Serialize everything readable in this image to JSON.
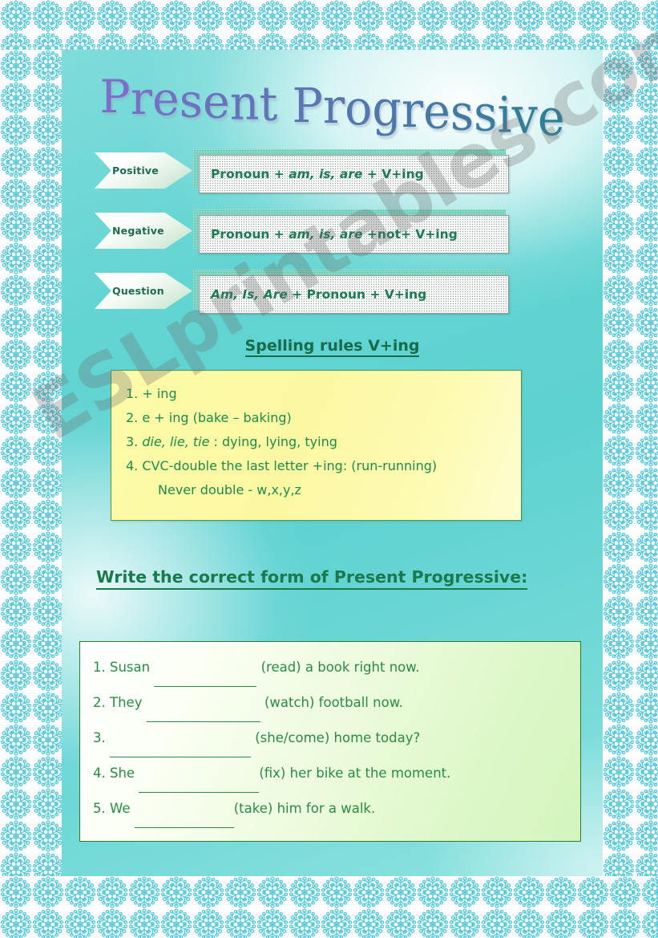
{
  "worksheet": {
    "title": "Present Progressive",
    "watermark": "ESLprintables.com",
    "colors": {
      "panel_teal": "#62d4d2",
      "heading_green": "#176b4a",
      "formula_green": "#1c7a57",
      "rules_yellow": "#fdfba9",
      "exercise_green": "#ddf7c8",
      "snowflake_cyan": "#4fc6d8",
      "title_start": "#7b6fc9",
      "title_end": "#2f7f96"
    }
  },
  "grammar_rows": [
    {
      "label": "Positive",
      "formula_pre": "Pronoun + ",
      "formula_italic": "am, is, are",
      "formula_post": " + V+ing"
    },
    {
      "label": "Negative",
      "formula_pre": "Pronoun + ",
      "formula_italic": "am, is, are",
      "formula_post": " +not+ V+ing"
    },
    {
      "label": "Question",
      "formula_pre": "",
      "formula_italic": "Am, Is, Are",
      "formula_post": " + Pronoun + V+ing"
    }
  ],
  "spelling": {
    "heading": "Spelling rules V+ing",
    "rules": [
      {
        "num": "1.",
        "pre": "+ ing",
        "italic": "",
        "post": ""
      },
      {
        "num": "2.",
        "pre": "e + ing    (bake – baking)",
        "italic": "",
        "post": ""
      },
      {
        "num": "3.",
        "pre": "",
        "italic": "die, lie, tie",
        "post": " : dying, lying, tying"
      },
      {
        "num": "4.",
        "pre": "CVC-double the last letter +ing: (run-running)",
        "italic": "",
        "post": ""
      }
    ],
    "sub_rule": "Never double - w,x,y,z"
  },
  "task": {
    "heading": "Write the correct form of Present Progressive:",
    "sentences": [
      {
        "num": "1.",
        "before": "Susan ",
        "blank_width": 128,
        "after": " (read) a book right now."
      },
      {
        "num": "2.",
        "before": "They ",
        "blank_width": 142,
        "after": " (watch) football now."
      },
      {
        "num": "3.",
        "before": "",
        "blank_width": 176,
        "after": " (she/come) home today?"
      },
      {
        "num": "4.",
        "before": "She ",
        "blank_width": 150,
        "after": "(fix) her bike at the moment."
      },
      {
        "num": "5.",
        "before": "We ",
        "blank_width": 124,
        "after": "(take) him for a walk."
      }
    ]
  }
}
